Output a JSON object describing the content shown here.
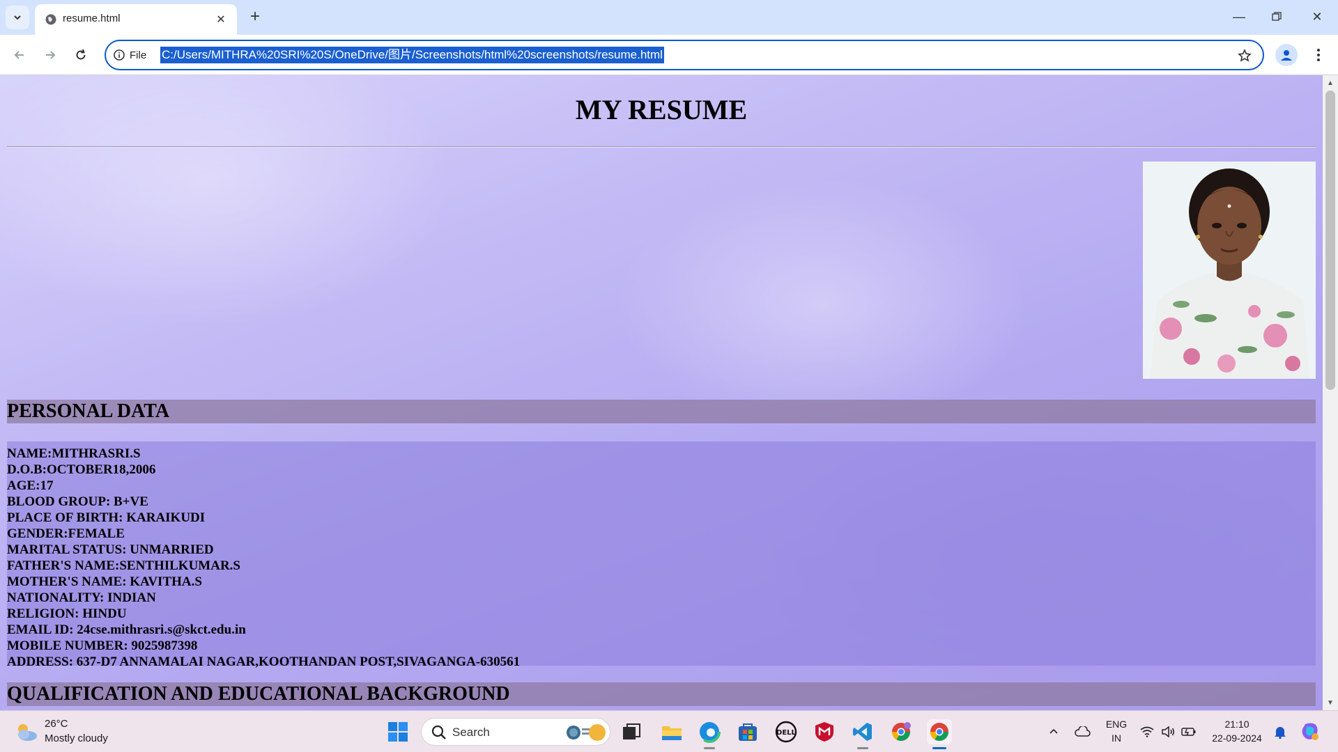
{
  "browser": {
    "tab_title": "resume.html",
    "site_info_label": "File",
    "url": "C:/Users/MITHRA%20SRI%20S/OneDrive/图片/Screenshots/html%20screenshots/resume.html"
  },
  "page": {
    "title": "MY RESUME",
    "photo_alt": "Profile photo",
    "sections": {
      "personal": "PERSONAL DATA",
      "qualification": "QUALIFICATION AND EDUCATIONAL BACKGROUND"
    },
    "personal_details": [
      "NAME:MITHRASRI.S",
      "D.O.B:OCTOBER18,2006",
      "AGE:17",
      "BLOOD GROUP: B+VE",
      "PLACE OF BIRTH: KARAIKUDI",
      "GENDER:FEMALE",
      "MARITAL STATUS: UNMARRIED",
      "FATHER'S NAME:SENTHILKUMAR.S",
      "MOTHER'S NAME: KAVITHA.S",
      "NATIONALITY: INDIAN",
      "RELIGION: HINDU",
      "EMAIL ID: 24cse.mithrasri.s@skct.edu.in",
      "MOBILE NUMBER: 9025987398",
      "ADDRESS: 637-D7 ANNAMALAI NAGAR,KOOTHANDAN POST,SIVAGANGA-630561"
    ]
  },
  "taskbar": {
    "weather_temp": "26°C",
    "weather_desc": "Mostly cloudy",
    "search_label": "Search",
    "lang_top": "ENG",
    "lang_bottom": "IN",
    "time": "21:10",
    "date": "22-09-2024"
  },
  "colors": {
    "accent": "#0b57d0",
    "section_band": "#8c78a0",
    "page_bg": "#b4a9f1"
  }
}
